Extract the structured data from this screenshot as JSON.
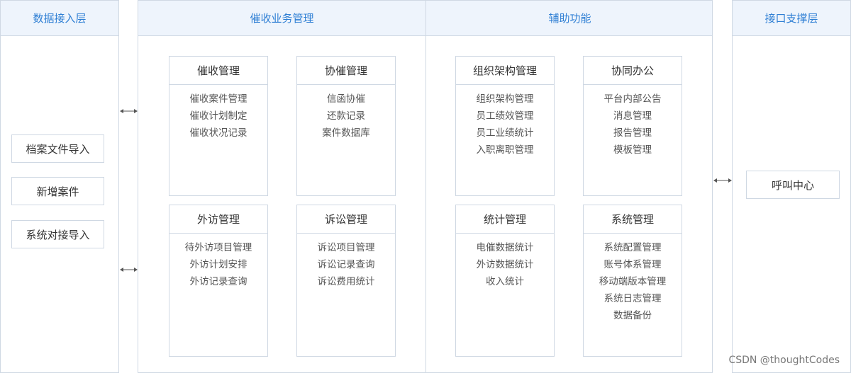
{
  "data_layer": {
    "title": "数据接入层",
    "items": [
      "档案文件导入",
      "新增案件",
      "系统对接导入"
    ]
  },
  "business": {
    "title": "催收业务管理",
    "modules": [
      {
        "title": "催收管理",
        "items": [
          "催收案件管理",
          "催收计划制定",
          "催收状况记录"
        ]
      },
      {
        "title": "协催管理",
        "items": [
          "信函协催",
          "还款记录",
          "案件数据库"
        ]
      },
      {
        "title": "外访管理",
        "items": [
          "待外访项目管理",
          "外访计划安排",
          "外访记录查询"
        ]
      },
      {
        "title": "诉讼管理",
        "items": [
          "诉讼项目管理",
          "诉讼记录查询",
          "诉讼费用统计"
        ]
      }
    ]
  },
  "auxiliary": {
    "title": "辅助功能",
    "modules": [
      {
        "title": "组织架构管理",
        "items": [
          "组织架构管理",
          "员工绩效管理",
          "员工业绩统计",
          "入职离职管理"
        ]
      },
      {
        "title": "协同办公",
        "items": [
          "平台内部公告",
          "消息管理",
          "报告管理",
          "模板管理"
        ]
      },
      {
        "title": "统计管理",
        "items": [
          "电催数据统计",
          "外访数据统计",
          "收入统计"
        ]
      },
      {
        "title": "系统管理",
        "items": [
          "系统配置管理",
          "账号体系管理",
          "移动端版本管理",
          "系统日志管理",
          "数据备份"
        ]
      }
    ]
  },
  "interface_layer": {
    "title": "接口支撑层",
    "items": [
      "呼叫中心"
    ]
  },
  "watermark": "CSDN @thoughtCodes",
  "colors": {
    "accent": "#2f7fd4",
    "header_bg": "#eef4fc",
    "border": "#cfd8e3"
  }
}
